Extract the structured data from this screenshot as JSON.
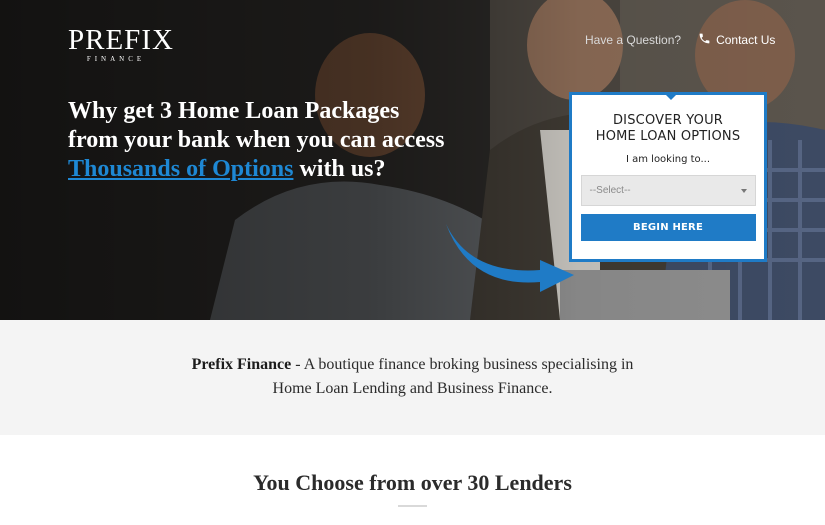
{
  "logo": {
    "main": "PREFIX",
    "sub": "FINANCE"
  },
  "nav": {
    "question": "Have a Question?",
    "contact": "Contact Us"
  },
  "hero": {
    "headline_line1": "Why get 3 Home Loan Packages",
    "headline_line2": "from your bank when you can access",
    "headline_link": "Thousands of Options",
    "headline_end": " with us?"
  },
  "form": {
    "title_line1": "DISCOVER YOUR",
    "title_line2": "HOME LOAN OPTIONS",
    "subtitle": "I am looking to...",
    "select_value": "--Select--",
    "button": "BEGIN HERE"
  },
  "intro": {
    "brand": "Prefix Finance",
    "text_line1": " - A boutique finance broking business specialising in",
    "text_line2": "Home Loan Lending and Business Finance."
  },
  "lenders": {
    "title": "You Choose from over 30 Lenders"
  },
  "colors": {
    "accent": "#1f7bc6",
    "link": "#1e88d4",
    "band": "#f4f4f4"
  }
}
